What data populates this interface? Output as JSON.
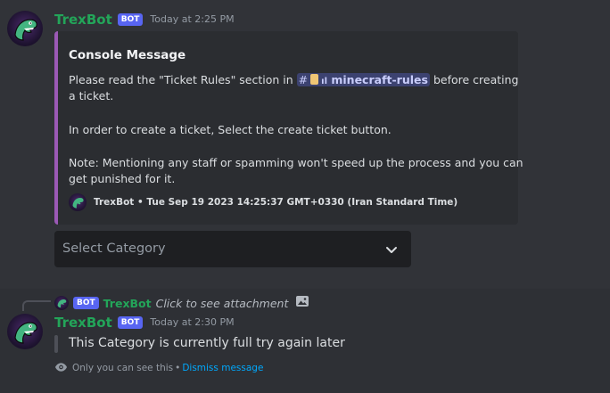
{
  "message1": {
    "author": "TrexBot",
    "badge": "BOT",
    "timestamp": "Today at 2:25 PM",
    "embed": {
      "title": "Console Message",
      "line1_before": "Please read the \"Ticket Rules\" section in",
      "channel_name": "minecraft-rules",
      "line1_after": "before creating",
      "line2": "a ticket.",
      "paragraph2": "In order to create a ticket, Select the create ticket button.",
      "paragraph3_line1": "Note: Mentioning any staff or spamming won't speed up the process and you can",
      "paragraph3_line2": "get punished for it.",
      "footer": "TrexBot • Tue Sep 19 2023 14:25:37 GMT+0330 (Iran Standard Time)",
      "accent_color": "#9b59b6"
    },
    "select_menu": {
      "placeholder": "Select Category"
    }
  },
  "message2": {
    "reply": {
      "badge": "BOT",
      "author": "TrexBot",
      "text": "Click to see attachment"
    },
    "author": "TrexBot",
    "badge": "BOT",
    "timestamp": "Today at 2:30 PM",
    "content": "This Category is currently full try again later",
    "ephemeral_note": "Only you can see this",
    "separator": "•",
    "dismiss_label": "Dismiss message"
  },
  "colors": {
    "background": "#313338",
    "username": "#23a559",
    "bot_badge": "#5865f2",
    "link": "#00a8fc"
  }
}
